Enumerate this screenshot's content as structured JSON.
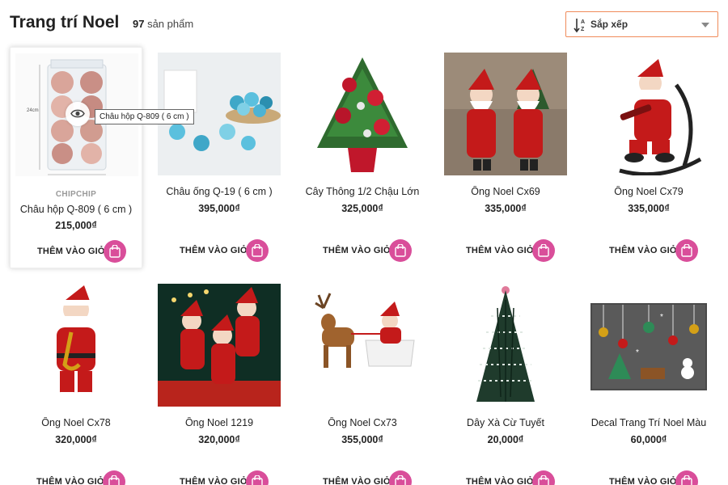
{
  "page": {
    "title": "Trang trí Noel",
    "count_number": "97",
    "count_suffix": " sản phẩm"
  },
  "sort": {
    "label": "Sắp xếp",
    "icon": "sort-az-icon"
  },
  "colors": {
    "accent_border": "#f08b5a",
    "cart_button": "#d94e9a"
  },
  "quickview": {
    "tooltip": "Châu hộp Q-809 ( 6 cm )",
    "icon": "eye-icon"
  },
  "add_label": "THÊM VÀO GIỎ",
  "products": [
    {
      "brand": "CHIPCHIP",
      "name": "Châu hộp Q-809 ( 6 cm )",
      "price": "215,000₫"
    },
    {
      "name": "Châu ống Q-19 ( 6 cm )",
      "price": "395,000₫"
    },
    {
      "name": "Cây Thông 1/2 Chậu Lớn",
      "price": "325,000₫"
    },
    {
      "name": "Ông Noel Cx69",
      "price": "335,000₫"
    },
    {
      "name": "Ông Noel Cx79",
      "price": "335,000₫"
    },
    {
      "name": "Ông Noel Cx78",
      "price": "320,000₫"
    },
    {
      "name": "Ông Noel 1219",
      "price": "320,000₫"
    },
    {
      "name": "Ông Noel Cx73",
      "price": "355,000₫"
    },
    {
      "name": "Dây Xà Cừ Tuyết",
      "price": "20,000₫"
    },
    {
      "name": "Decal Trang Trí Noel Màu",
      "price": "60,000₫"
    }
  ]
}
